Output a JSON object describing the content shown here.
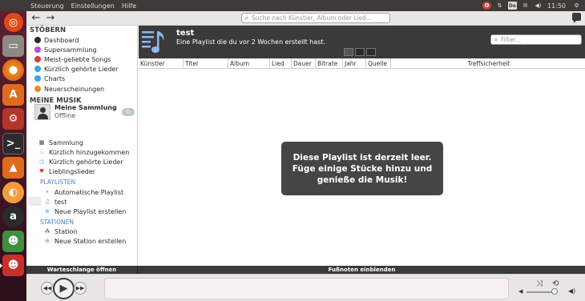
{
  "top_panel": {
    "menu": [
      "Steuerung",
      "Einstellungen",
      "Hilfe"
    ],
    "clock": "11:50",
    "tray": [
      "ubuntu-one-icon",
      "network-icon",
      "keyboard-layout-icon",
      "mail-icon",
      "volume-icon"
    ],
    "keyboard_label": "De"
  },
  "toolbar": {
    "search_placeholder": "Suche nach Künstler, Album oder Lied..."
  },
  "sidebar": {
    "browse_header": "STÖBERN",
    "browse": [
      {
        "label": "Dashboard",
        "color": "#2b2b2b"
      },
      {
        "label": "Supersammlung",
        "color": "#b44fd1"
      },
      {
        "label": "Meist-geliebte Songs",
        "color": "#e03a3a"
      },
      {
        "label": "Kürzlich gehörte Lieder",
        "color": "#3aa3e0"
      },
      {
        "label": "Charts",
        "color": "#3aa3e0"
      },
      {
        "label": "Neuerscheinungen",
        "color": "#f08a24"
      }
    ],
    "music_header": "MEINE MUSIK",
    "collection": {
      "name": "Meine Sammlung",
      "status": "Offline",
      "count": "0"
    },
    "music": [
      {
        "label": "Sammlung"
      },
      {
        "label": "Kürzlich hinzugekommen"
      },
      {
        "label": "Kürzlich gehörte Lieder"
      },
      {
        "label": "Lieblingslieder"
      }
    ],
    "playlists_header": "PLAYLISTEN",
    "playlists": [
      {
        "label": "Automatische Playlist"
      },
      {
        "label": "test"
      },
      {
        "label": "Neue Playlist erstellen"
      }
    ],
    "stations_header": "STATIONEN",
    "stations": [
      {
        "label": "Station"
      },
      {
        "label": "Neue Station erstellen"
      }
    ]
  },
  "main": {
    "title": "test",
    "subtitle": "Eine Playlist die du vor 2 Wochen erstellt hast.",
    "filter_placeholder": "Filter...",
    "columns": [
      "Künstler",
      "Titel",
      "Album",
      "Lied",
      "Dauer",
      "Bitrate",
      "Jahr",
      "Quelle",
      "Treffsicherheit"
    ],
    "empty_line1": "Diese Playlist ist derzeit leer.",
    "empty_line2": "Füge einige Stücke hinzu und",
    "empty_line3": "genieße die Musik!"
  },
  "bottom": {
    "queue_label": "Warteschlange öffnen",
    "footnotes_label": "Fußnoten einblenden"
  }
}
